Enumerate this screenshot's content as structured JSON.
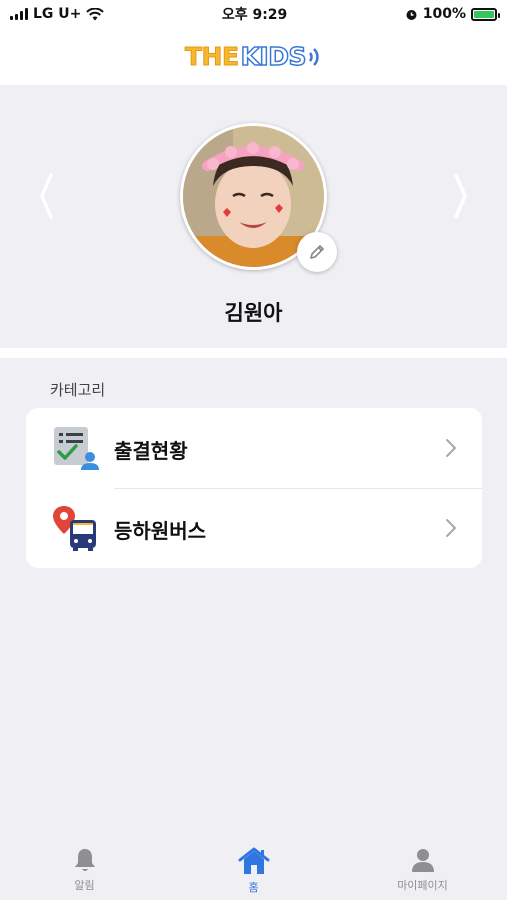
{
  "status_bar": {
    "carrier": "LG U+",
    "time": "오후 9:29",
    "battery_percent": "100%"
  },
  "header": {
    "logo_part1": "THE",
    "logo_part2": "KIDS"
  },
  "profile": {
    "child_name": "김원아"
  },
  "category": {
    "section_label": "카테고리",
    "items": [
      {
        "label": "출결현황",
        "icon": "attendance-icon"
      },
      {
        "label": "등하원버스",
        "icon": "bus-icon"
      }
    ]
  },
  "tab_bar": {
    "tabs": [
      {
        "label": "알림",
        "icon": "bell-icon",
        "active": false
      },
      {
        "label": "홈",
        "icon": "home-icon",
        "active": true
      },
      {
        "label": "마이페이지",
        "icon": "person-icon",
        "active": false
      }
    ]
  },
  "colors": {
    "accent": "#2f76e0",
    "background": "#efeff4",
    "inactive_tab": "#8e8e93"
  }
}
